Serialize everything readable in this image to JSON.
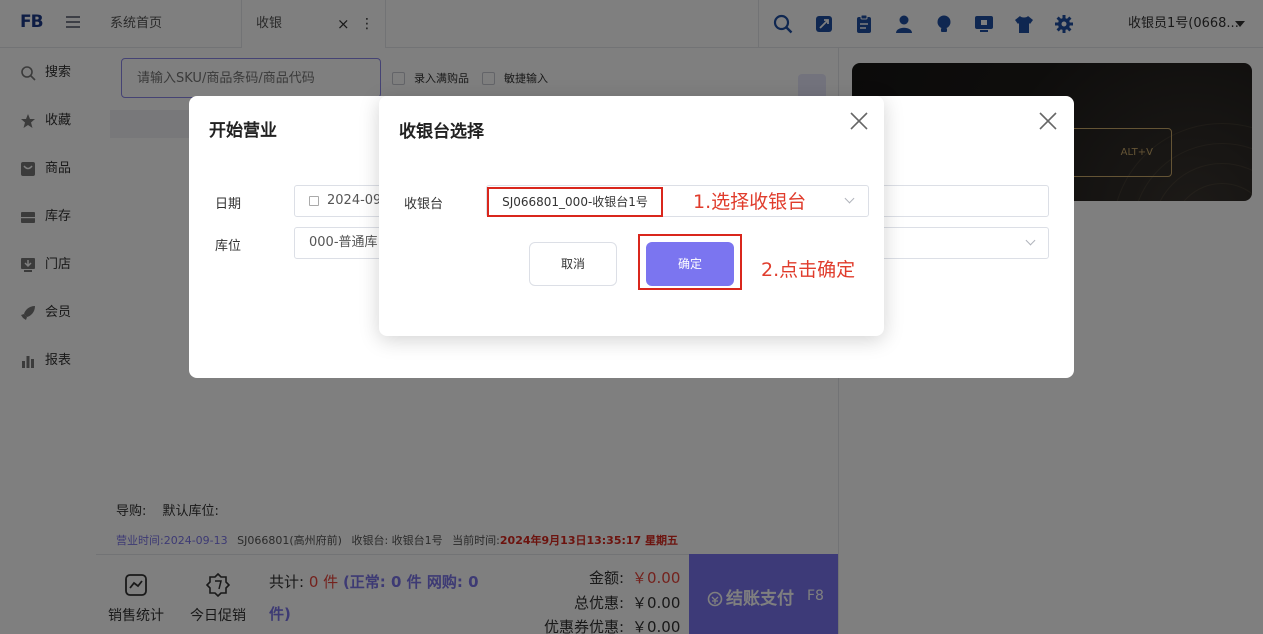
{
  "app": {
    "logo_text": "FB"
  },
  "tabs": [
    {
      "label": "系统首页"
    },
    {
      "label": "收银",
      "close": "×",
      "more": "⋮"
    }
  ],
  "top_icons": [
    "search-icon",
    "scan-icon",
    "clipboard-icon",
    "user-icon",
    "bulb-icon",
    "monitor-icon",
    "shirt-icon",
    "gear-icon"
  ],
  "user": {
    "label": "收银员1号(0668..."
  },
  "sidebar": {
    "items": [
      {
        "label": "搜索",
        "icon": "search-icon"
      },
      {
        "label": "收藏",
        "icon": "star-icon"
      },
      {
        "label": "商品",
        "icon": "goods-icon"
      },
      {
        "label": "库存",
        "icon": "inventory-icon"
      },
      {
        "label": "门店",
        "icon": "store-icon"
      },
      {
        "label": "会员",
        "icon": "rocket-icon"
      },
      {
        "label": "报表",
        "icon": "chart-icon"
      }
    ]
  },
  "main": {
    "search_placeholder": "请输入SKU/商品条码/商品代码",
    "checkbox1": "录入满购品",
    "checkbox2": "敏捷输入",
    "guide_label": "导购:",
    "warehouse_label": "默认库位:",
    "info": {
      "business_time_label": "营业时间:",
      "business_time": "2024-09-13",
      "store": "SJ066801(高州府前)",
      "register": "收银台: 收银台1号",
      "current_time_label": "当前时间:",
      "current_time": "2024年9月13日13:35:17 星期五"
    }
  },
  "bottom": {
    "sales_stats": "销售统计",
    "today_promo": "今日促销",
    "total_label": "共计:",
    "total_count": "0 件",
    "total_detail": "(正常: 0 件  网购: 0",
    "total_detail2": "件)",
    "amount_label": "金额:",
    "amount": "￥0.00",
    "discount_label": "总优惠:",
    "discount": "￥0.00",
    "coupon_label": "优惠券优惠:",
    "coupon": "￥0.00",
    "pay_label": "结账支付",
    "pay_key": "F8"
  },
  "right_panel": {
    "vip_shortcut": "ALT+V"
  },
  "open_dialog": {
    "title": "开始营业",
    "date_label": "日期",
    "date_value": "2024-09-",
    "location_label": "库位",
    "location_value": "000-普通库"
  },
  "register_dialog": {
    "title": "收银台选择",
    "register_label": "收银台",
    "register_value": "SJ066801_000-收银台1号",
    "annotation1": "1.选择收银台",
    "cancel": "取消",
    "confirm": "确定",
    "annotation2": "2.点击确定"
  },
  "colors": {
    "accent": "#7b75f0",
    "annotation_red": "#e03c2c",
    "amount_red": "#e8443a"
  }
}
